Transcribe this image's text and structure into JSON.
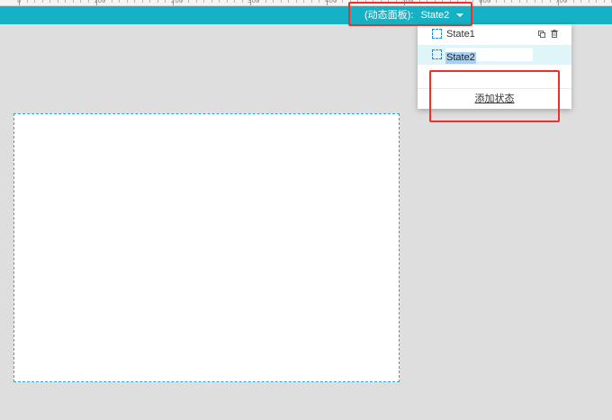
{
  "ruler": {
    "labels": [
      "0",
      "100",
      "200",
      "300",
      "400",
      "500",
      "600",
      "700"
    ]
  },
  "toolbar": {
    "panel_label": "(动态面板):",
    "current_state": "State2"
  },
  "dropdown": {
    "states": [
      {
        "label": "State1",
        "selected": false
      },
      {
        "label": "State2",
        "selected": true,
        "editing": true
      }
    ],
    "add_state_label": "添加状态"
  },
  "colors": {
    "toolbar": "#14b2c4",
    "highlight": "#e8322b",
    "selected_row": "#e0f5f7",
    "text_selection": "#a8d0f2"
  },
  "icons": {
    "state": "dashed-square",
    "duplicate": "copy-icon",
    "delete": "trash-icon",
    "caret": "caret-down-icon"
  }
}
